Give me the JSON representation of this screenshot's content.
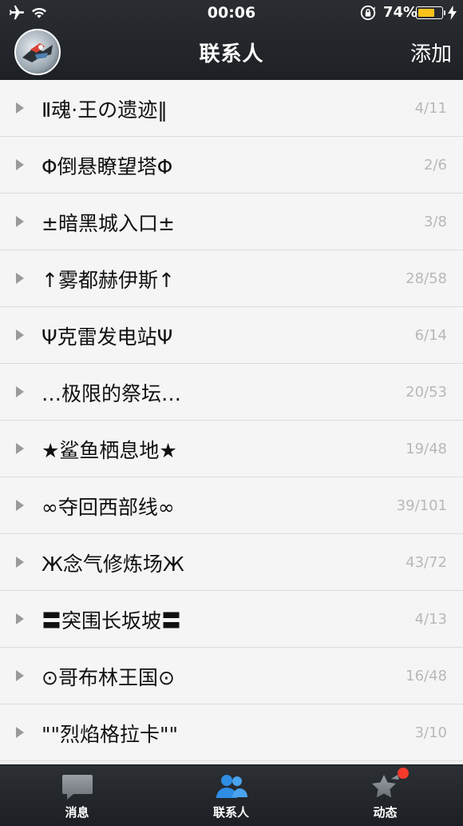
{
  "status_bar": {
    "time": "00:06",
    "battery_percent": "74%",
    "battery_level": 0.74,
    "icons": [
      "airplane-icon",
      "wifi-icon",
      "orientation-lock-icon",
      "battery-icon",
      "charging-icon"
    ]
  },
  "nav": {
    "title": "联系人",
    "add_label": "添加"
  },
  "groups": [
    {
      "name": "Ⅱ魂·王の遗迹‖",
      "count": "4/11"
    },
    {
      "name": "Φ倒悬瞭望塔Φ",
      "count": "2/6"
    },
    {
      "name": "±暗黑城入口±",
      "count": "3/8"
    },
    {
      "name": "↑雾都赫伊斯↑",
      "count": "28/58"
    },
    {
      "name": "Ψ克雷发电站Ψ",
      "count": "6/14"
    },
    {
      "name": "…极限的祭坛…",
      "count": "20/53"
    },
    {
      "name": "★鲨鱼栖息地★",
      "count": "19/48"
    },
    {
      "name": "∞夺回西部线∞",
      "count": "39/101"
    },
    {
      "name": "Ж念气修炼场Ж",
      "count": "43/72"
    },
    {
      "name": "〓突围长坂坡〓",
      "count": "4/13"
    },
    {
      "name": "⊙哥布林王国⊙",
      "count": "16/48"
    },
    {
      "name": "\"\"烈焰格拉卡\"\"",
      "count": "3/10"
    }
  ],
  "tabbar": {
    "messages_label": "消息",
    "contacts_label": "联系人",
    "feed_label": "动态"
  },
  "colors": {
    "bar_bg": "#1f2226",
    "battery_fill": "#f7c31b",
    "contacts_icon": "#2f8de4",
    "badge": "#f33a2b"
  }
}
